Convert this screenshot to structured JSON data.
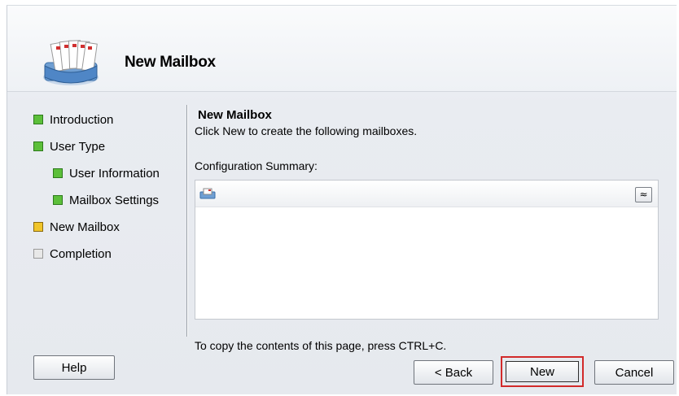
{
  "header": {
    "title": "New Mailbox",
    "icon": "mailbox-stack-icon"
  },
  "steps": [
    {
      "label": "Introduction",
      "status": "complete",
      "color": "#5cbf3a"
    },
    {
      "label": "User Type",
      "status": "complete",
      "color": "#5cbf3a"
    },
    {
      "label": "User Information",
      "status": "complete",
      "color": "#5cbf3a"
    },
    {
      "label": "Mailbox Settings",
      "status": "complete",
      "color": "#5cbf3a"
    },
    {
      "label": "New Mailbox",
      "status": "current",
      "color": "#f0c52a"
    },
    {
      "label": "Completion",
      "status": "pending",
      "color": "#e8e8e8"
    }
  ],
  "content": {
    "title": "New Mailbox",
    "description": "Click New to create the following mailboxes.",
    "config_label": "Configuration Summary:",
    "summary_row_icon": "mailbox-icon",
    "collapse_glyph": "≈"
  },
  "footer": {
    "copy_note": "To copy the contents of this page, press CTRL+C.",
    "help_label": "Help",
    "back_label": "< Back",
    "new_label": "New",
    "cancel_label": "Cancel",
    "highlight_color": "#d22a2a"
  }
}
